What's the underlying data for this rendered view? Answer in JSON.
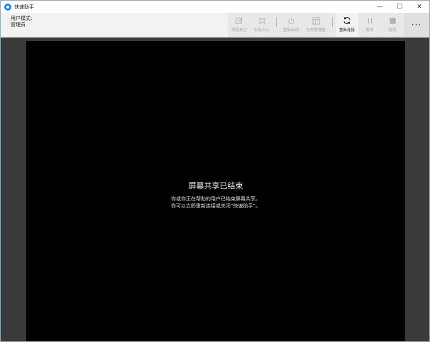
{
  "window": {
    "title": "快速助手",
    "controls": {
      "minimize": "—",
      "maximize": "☐",
      "close": "✕"
    }
  },
  "toolbar": {
    "mode_label": "用户模式:",
    "role_label": "管理员",
    "tools": [
      {
        "id": "annotate",
        "label": "添加批注",
        "icon": "pencil-square-icon",
        "enabled": false
      },
      {
        "id": "actual-size",
        "label": "实际大小",
        "icon": "fit-size-icon",
        "enabled": false
      },
      {
        "id": "restart",
        "label": "重新启动",
        "icon": "power-icon",
        "enabled": false
      },
      {
        "id": "task-manager",
        "label": "任务管理器",
        "icon": "task-manager-icon",
        "enabled": false
      },
      {
        "id": "reconnect",
        "label": "重新连接",
        "icon": "refresh-icon",
        "enabled": true
      },
      {
        "id": "pause",
        "label": "暂停",
        "icon": "pause-icon",
        "enabled": false
      },
      {
        "id": "end",
        "label": "结束",
        "icon": "stop-icon",
        "enabled": false
      }
    ],
    "more_label": "···"
  },
  "screen": {
    "title": "屏幕共享已结束",
    "line1": "你或你正在帮助的用户已结束屏幕共享。",
    "line2": "你可以立即重新连接或关闭“快速助手”。"
  }
}
